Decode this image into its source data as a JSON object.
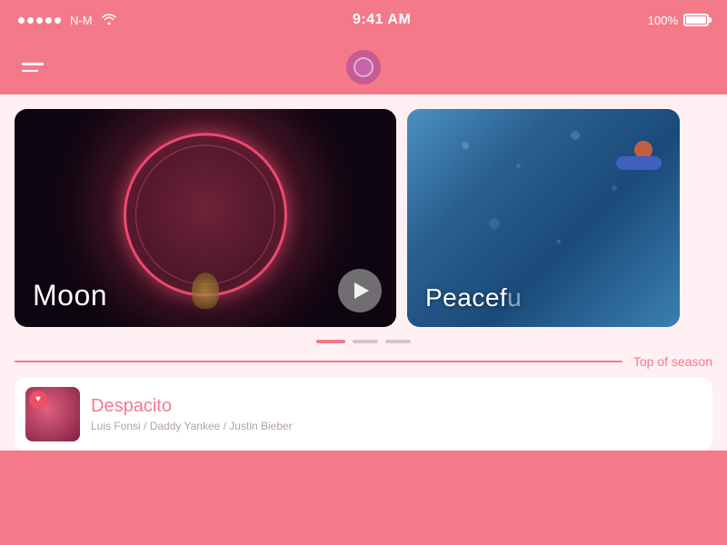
{
  "statusBar": {
    "carrier": "N-M",
    "time": "9:41 AM",
    "battery": "100%"
  },
  "header": {
    "logoAlt": "App Logo"
  },
  "cards": [
    {
      "id": "card-1",
      "title": "Moon",
      "type": "main"
    },
    {
      "id": "card-2",
      "title": "Peacefullyfe",
      "displayTitle": "Peacef...",
      "type": "secondary"
    }
  ],
  "pagination": {
    "dots": [
      {
        "active": true
      },
      {
        "active": false
      },
      {
        "active": false
      }
    ]
  },
  "topSeason": {
    "label": "Top of season"
  },
  "songList": [
    {
      "title": "Despacito",
      "artist": "Luis Fonsi / Daddy Yankee / Justin Bieber",
      "liked": true
    }
  ],
  "playButton": {
    "label": "▶"
  }
}
